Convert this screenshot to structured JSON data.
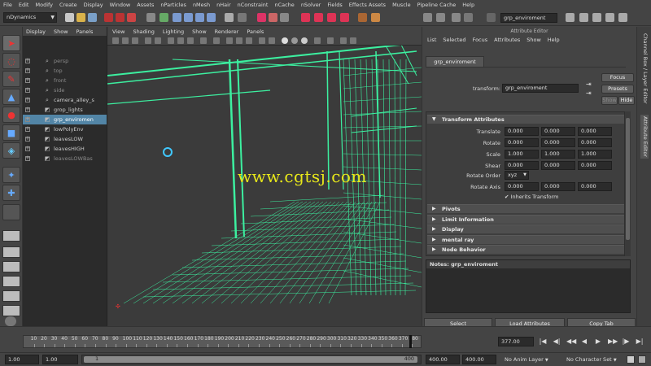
{
  "menubar": [
    "File",
    "Edit",
    "Modify",
    "Create",
    "Display",
    "Window",
    "Assets",
    "nParticles",
    "nMesh",
    "nHair",
    "nConstraint",
    "nCache",
    "nSolver",
    "Fields",
    "Effects Assets",
    "Muscle",
    "Pipeline Cache",
    "Help"
  ],
  "shelf": {
    "mode": "nDynamics",
    "object_field": "grp_enviroment"
  },
  "outliner": {
    "menu": [
      "Display",
      "Show",
      "Panels"
    ],
    "items": [
      {
        "label": "persp",
        "dim": true
      },
      {
        "label": "top",
        "dim": true
      },
      {
        "label": "front",
        "dim": true
      },
      {
        "label": "side",
        "dim": true
      },
      {
        "label": "camera_alley_s",
        "dim": false
      },
      {
        "label": "grop_lights",
        "dim": false
      },
      {
        "label": "grp_enviromen",
        "dim": false,
        "selected": true
      },
      {
        "label": "lowPolyEnv",
        "dim": false
      },
      {
        "label": "leavesLOW",
        "dim": false
      },
      {
        "label": "leavesHIGH",
        "dim": false
      },
      {
        "label": "leavesLOWBas",
        "dim": true
      }
    ]
  },
  "viewport": {
    "menu": [
      "View",
      "Shading",
      "Lighting",
      "Show",
      "Renderer",
      "Panels"
    ],
    "watermark": "www.cgtsj.com",
    "wire_color": "#3cf0a0"
  },
  "attribute_editor": {
    "title": "Attribute Editor",
    "menu": [
      "List",
      "Selected",
      "Focus",
      "Attributes",
      "Show",
      "Help"
    ],
    "tab": "grp_enviroment",
    "transform_label": "transform:",
    "transform_value": "grp_enviroment",
    "focus": "Focus",
    "presets": "Presets",
    "show": "Show",
    "hide": "Hide",
    "section_transform": "Transform Attributes",
    "rows": [
      {
        "label": "Translate",
        "values": [
          "0.000",
          "0.000",
          "0.000"
        ]
      },
      {
        "label": "Rotate",
        "values": [
          "0.000",
          "0.000",
          "0.000"
        ]
      },
      {
        "label": "Scale",
        "values": [
          "1.000",
          "1.000",
          "1.000"
        ]
      },
      {
        "label": "Shear",
        "values": [
          "0.000",
          "0.000",
          "0.000"
        ]
      }
    ],
    "rotate_order_label": "Rotate Order",
    "rotate_order_value": "xyz",
    "rotate_axis_label": "Rotate Axis",
    "rotate_axis_values": [
      "0.000",
      "0.000",
      "0.000"
    ],
    "inherits": "Inherits Transform",
    "collapsed_sections": [
      "Pivots",
      "Limit Information",
      "Display",
      "mental ray",
      "Node Behavior"
    ],
    "notes": "Notes: grp_enviroment",
    "buttons": [
      "Select",
      "Load Attributes",
      "Copy Tab"
    ]
  },
  "side_tabs": [
    "Channel Box / Layer Editor",
    "Attribute Editor"
  ],
  "timeslider": {
    "ticks": [
      "10",
      "20",
      "30",
      "40",
      "50",
      "60",
      "70",
      "80",
      "90",
      "100",
      "110",
      "120",
      "130",
      "140",
      "150",
      "160",
      "170",
      "180",
      "190",
      "200",
      "210",
      "220",
      "230",
      "240",
      "250",
      "260",
      "270",
      "280",
      "290",
      "300",
      "310",
      "320",
      "330",
      "340",
      "350",
      "360",
      "370",
      "380"
    ],
    "current": "377.00",
    "buttons": [
      "|◀",
      "◀|",
      "◀◀",
      "◀",
      "▶",
      "▶▶",
      "|▶",
      "▶|"
    ]
  },
  "range": {
    "start": "1.00",
    "inner_start": "1.00",
    "range_marker": "1",
    "inner_end": "400",
    "end": "400.00",
    "end2": "400.00",
    "anim_layer": "No Anim Layer",
    "character_set": "No Character Set"
  }
}
